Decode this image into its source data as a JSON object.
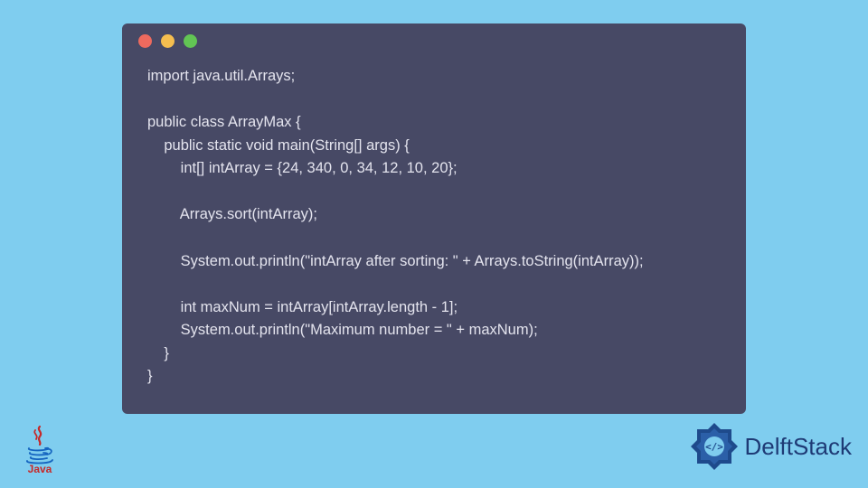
{
  "colors": {
    "page_bg": "#7fcdef",
    "window_bg": "#474965",
    "code_text": "#e4e4ee",
    "dot_red": "#ed6a5e",
    "dot_yellow": "#f5be4f",
    "dot_green": "#62c554",
    "java_red": "#c62828",
    "delft_blue": "#1e3a75"
  },
  "code": {
    "lines": [
      "import java.util.Arrays;",
      "",
      "public class ArrayMax {",
      "    public static void main(String[] args) {",
      "        int[] intArray = {24, 340, 0, 34, 12, 10, 20};",
      "",
      "        Arrays.sort(intArray);",
      "",
      "        System.out.println(\"intArray after sorting: \" + Arrays.toString(intArray));",
      "",
      "        int maxNum = intArray[intArray.length - 1];",
      "        System.out.println(\"Maximum number = \" + maxNum);",
      "    }",
      "}"
    ]
  },
  "logos": {
    "java_label": "Java",
    "delft_label": "DelftStack"
  }
}
